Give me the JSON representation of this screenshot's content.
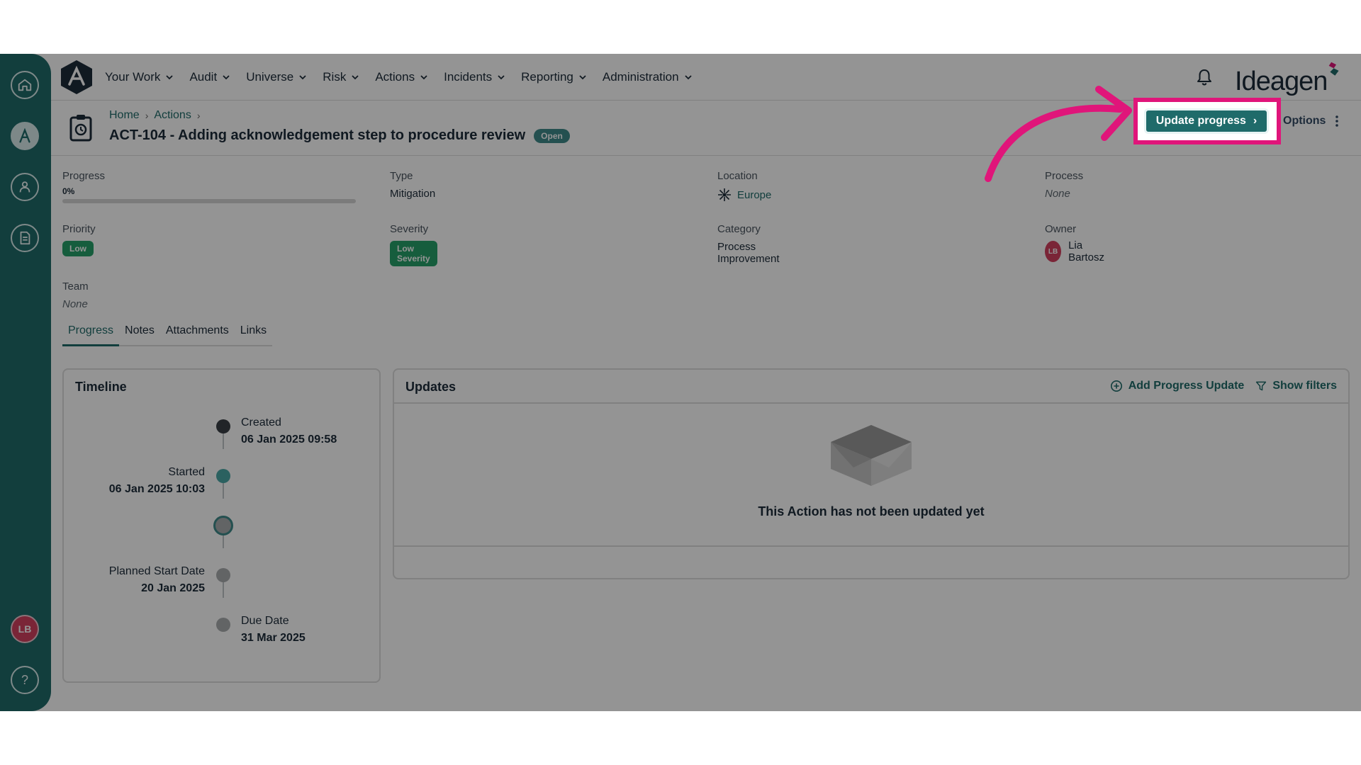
{
  "nav": {
    "items": [
      {
        "label": "Your Work"
      },
      {
        "label": "Audit"
      },
      {
        "label": "Universe"
      },
      {
        "label": "Risk"
      },
      {
        "label": "Actions"
      },
      {
        "label": "Incidents"
      },
      {
        "label": "Reporting"
      },
      {
        "label": "Administration"
      }
    ],
    "brand": "Ideagen"
  },
  "sidebar": {
    "user_initials": "LB",
    "help": "?"
  },
  "header": {
    "breadcrumb": [
      "Home",
      "Actions"
    ],
    "title": "ACT-104 - Adding acknowledgement step to procedure review",
    "status": "Open",
    "update_button": "Update progress",
    "options_label": "Options"
  },
  "fields": {
    "progress": {
      "label": "Progress",
      "value": "0%",
      "fraction": 0
    },
    "type": {
      "label": "Type",
      "value": "Mitigation"
    },
    "location": {
      "label": "Location",
      "value": "Europe"
    },
    "process": {
      "label": "Process",
      "value": "None"
    },
    "priority": {
      "label": "Priority",
      "value": "Low"
    },
    "severity": {
      "label": "Severity",
      "value": "Low Severity"
    },
    "category": {
      "label": "Category",
      "value": "Process Improvement"
    },
    "owner": {
      "label": "Owner",
      "value": "Lia Bartosz",
      "initials": "LB"
    },
    "team": {
      "label": "Team",
      "value": "None"
    }
  },
  "tabs": [
    {
      "label": "Progress",
      "active": true
    },
    {
      "label": "Notes",
      "active": false
    },
    {
      "label": "Attachments",
      "active": false
    },
    {
      "label": "Links",
      "active": false
    }
  ],
  "timeline": {
    "title": "Timeline",
    "events": [
      {
        "label": "Created",
        "date": "06 Jan 2025 09:58"
      },
      {
        "label": "Started",
        "date": "06 Jan 2025 10:03"
      },
      {
        "label": "Planned Start Date",
        "date": "20 Jan 2025"
      },
      {
        "label": "Due Date",
        "date": "31 Mar 2025"
      }
    ]
  },
  "updates": {
    "title": "Updates",
    "add_label": "Add Progress Update",
    "filters_label": "Show filters",
    "empty_message": "This Action has not been updated yet"
  },
  "colors": {
    "brand_teal": "#1f6b6a",
    "highlight_pink": "#e0157a",
    "badge_green": "#27a06a",
    "avatar_red": "#d2415f"
  }
}
